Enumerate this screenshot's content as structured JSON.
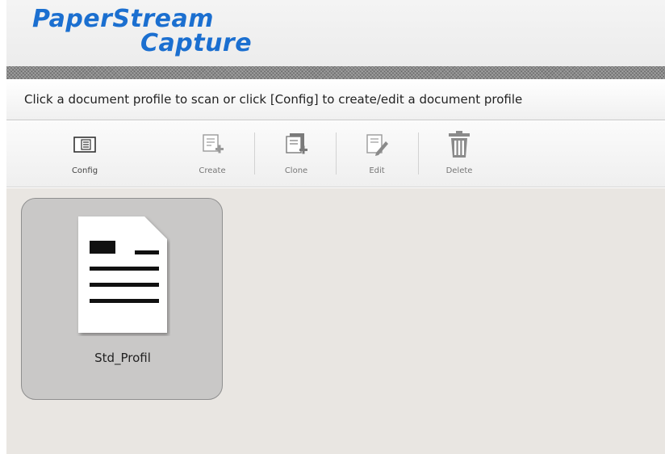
{
  "header": {
    "logo_line1": "PaperStream",
    "logo_line2": "Capture"
  },
  "instruction": "Click a document profile to scan or click [Config] to create/edit a document profile",
  "toolbar": {
    "items": [
      {
        "label": "Config",
        "icon": "config-icon",
        "enabled": true
      },
      {
        "label": "Create",
        "icon": "create-icon",
        "enabled": false
      },
      {
        "label": "Clone",
        "icon": "clone-icon",
        "enabled": false
      },
      {
        "label": "Edit",
        "icon": "edit-icon",
        "enabled": false
      },
      {
        "label": "Delete",
        "icon": "delete-icon",
        "enabled": false
      }
    ]
  },
  "profiles": [
    {
      "name": "Std_Profil",
      "icon": "document-icon"
    }
  ],
  "colors": {
    "logo": "#1b6fd0",
    "content_bg": "#e9e6e2",
    "card_bg": "#c9c8c7"
  }
}
